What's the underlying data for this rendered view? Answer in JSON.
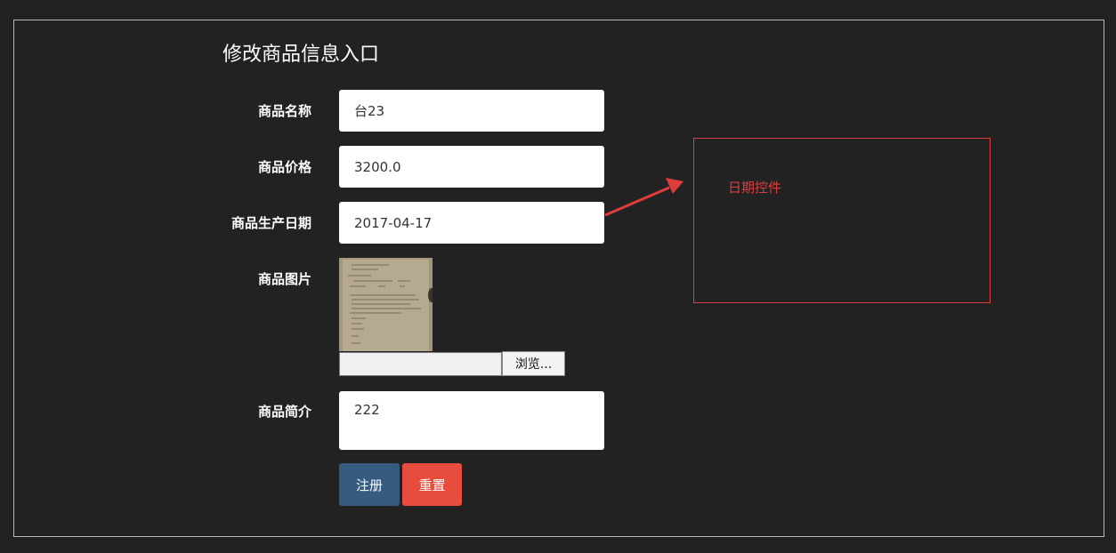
{
  "form": {
    "title": "修改商品信息入口",
    "fields": {
      "name": {
        "label": "商品名称",
        "value": "台23"
      },
      "price": {
        "label": "商品价格",
        "value": "3200.0"
      },
      "date": {
        "label": "商品生产日期",
        "value": "2017-04-17"
      },
      "image": {
        "label": "商品图片",
        "browse_label": "浏览..."
      },
      "description": {
        "label": "商品简介",
        "value": "222"
      }
    },
    "buttons": {
      "submit": "注册",
      "reset": "重置"
    }
  },
  "annotation": {
    "text": "日期控件",
    "color": "#e03c3c"
  },
  "colors": {
    "background": "#222222",
    "submit_button": "#375a7f",
    "reset_button": "#e74c3c"
  }
}
